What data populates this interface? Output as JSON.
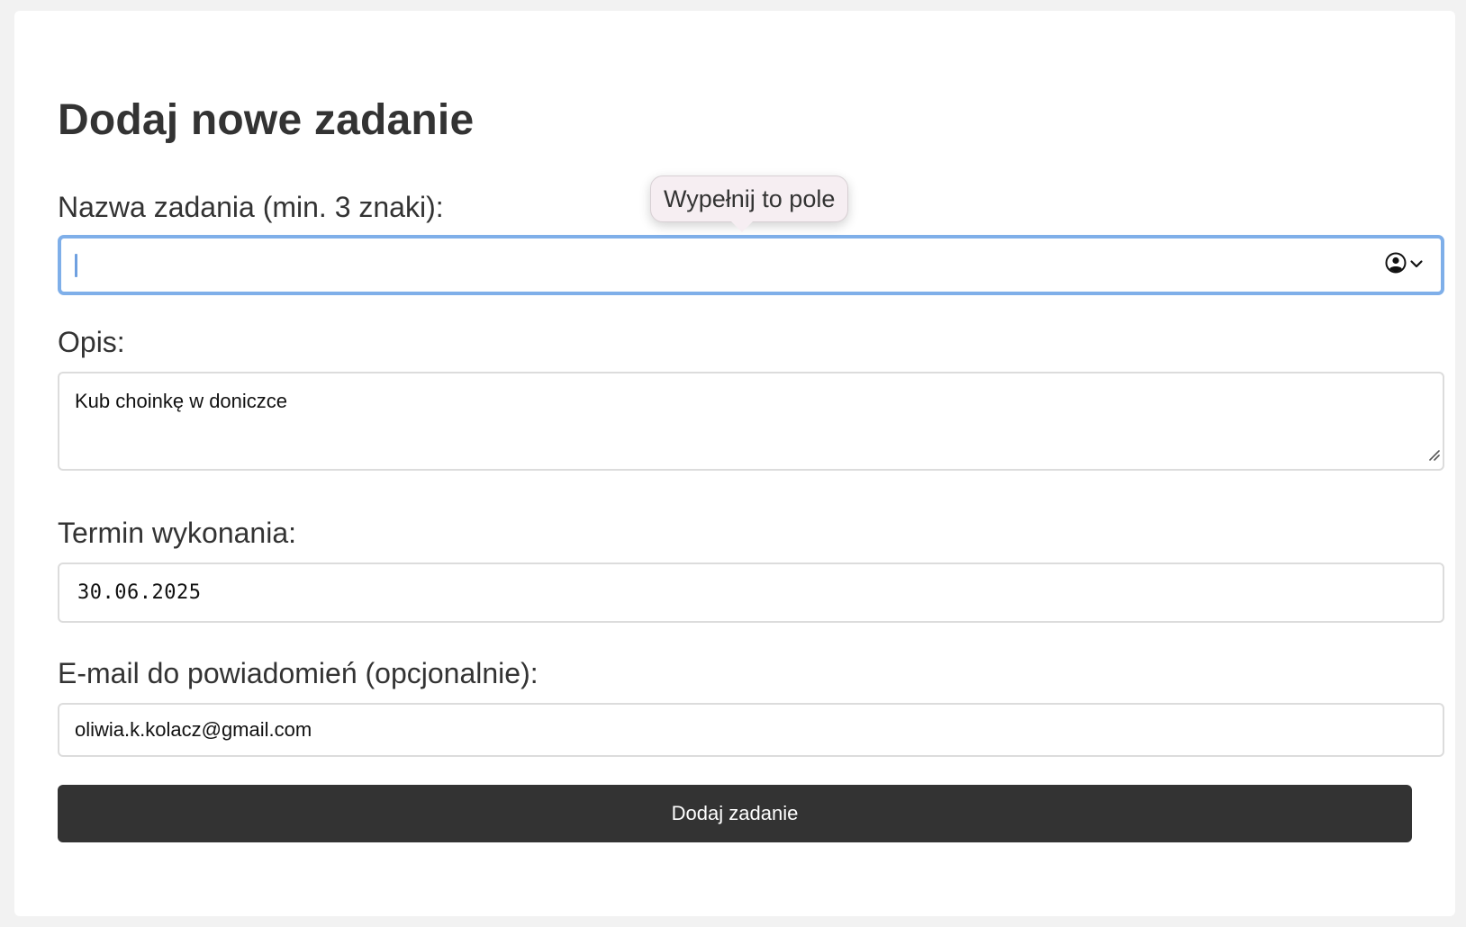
{
  "form": {
    "heading": "Dodaj nowe zadanie",
    "name_label": "Nazwa zadania (min. 3 znaki):",
    "name_value": "",
    "description_label": "Opis:",
    "description_value": "Kub choinkę w doniczce",
    "due_date_label": "Termin wykonania:",
    "due_date_value": "30.06.2025",
    "email_label": "E-mail do powiadomień (opcjonalnie):",
    "email_value": "oliwia.k.kolacz@gmail.com",
    "submit_label": "Dodaj zadanie"
  },
  "tooltip": {
    "text": "Wypełnij to pole"
  },
  "icons": {
    "autofill": "contact-autofill-icon",
    "chevron": "chevron-down-icon",
    "resize": "resize-handle-icon"
  },
  "colors": {
    "focus_ring": "#7fafe9",
    "button_bg": "#333333",
    "button_text": "#ffffff",
    "page_bg": "#f2f2f2",
    "tooltip_bg": "#f6eef2"
  }
}
